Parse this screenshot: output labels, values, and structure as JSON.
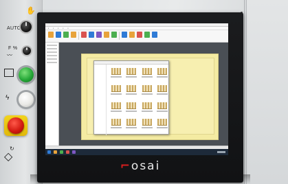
{
  "control_panel": {
    "mode_label": "AUTO",
    "feed_label": "F %",
    "buttons": [
      {
        "name": "start",
        "color": "#26a838"
      },
      {
        "name": "stop",
        "color": "#e9e9e6"
      },
      {
        "name": "emergency-stop",
        "color": "#d31b12"
      }
    ]
  },
  "monitor": {
    "brand": "osai",
    "screen": {
      "taskbar_colors": [
        "#2f7bd6",
        "#e8a33b",
        "#4caf50",
        "#d9534f",
        "#7e57c2"
      ],
      "ribbon_colors": [
        "#e8a33b",
        "#2f7bd6",
        "#4caf50",
        "#e8a33b",
        "#d9534f",
        "#2f7bd6",
        "#7e57c2",
        "#e8a33b",
        "#4caf50",
        "#2f7bd6",
        "#e8a33b",
        "#d9534f",
        "#4caf50",
        "#2f7bd6"
      ],
      "sheet_color": "#f4eba2"
    }
  }
}
